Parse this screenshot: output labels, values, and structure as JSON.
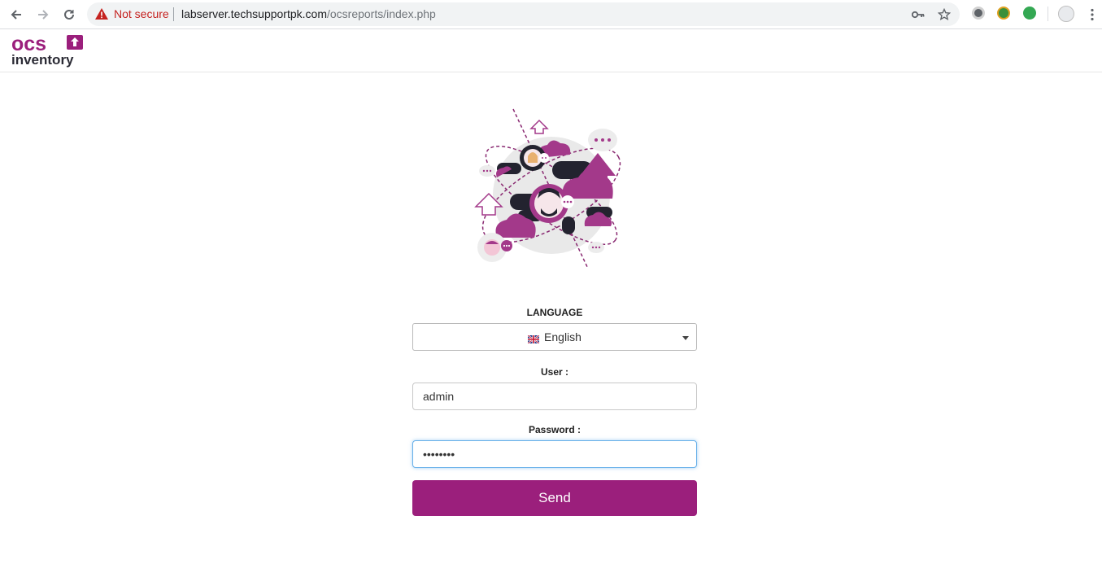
{
  "browser": {
    "security_text": "Not secure",
    "url_host": "labserver.techsupportpk.com",
    "url_path": "/ocsreports/index.php",
    "icons": [
      "back-icon",
      "forward-icon",
      "reload-icon",
      "warning-icon",
      "key-icon",
      "star-icon",
      "menu-icon"
    ]
  },
  "logo": {
    "line1": "ocs",
    "line2": "inventory"
  },
  "form": {
    "language_label": "LANGUAGE",
    "language_value": "English",
    "user_label": "User :",
    "user_value": "admin",
    "password_label": "Password :",
    "password_value": "password",
    "send_label": "Send"
  },
  "colors": {
    "brand_purple": "#9b1f7c",
    "logo_dark": "#2b2b35",
    "warning_red": "#c5221f"
  }
}
